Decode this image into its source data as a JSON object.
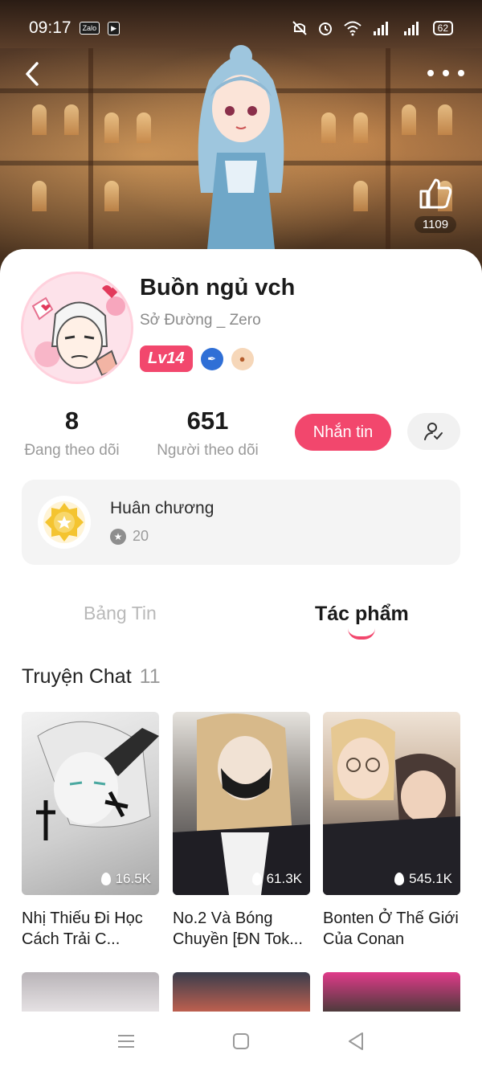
{
  "status_bar": {
    "time": "09:17",
    "app_icons": [
      "Zalo",
      "▶"
    ],
    "battery": "62"
  },
  "header": {
    "like_count": "1109"
  },
  "profile": {
    "name": "Buồn ngủ vch",
    "subtitle": "Sở Đường _ Zero",
    "level": "Lv14"
  },
  "stats": [
    {
      "value": "8",
      "label": "Đang theo dõi"
    },
    {
      "value": "651",
      "label": "Người theo dõi"
    }
  ],
  "actions": {
    "message_label": "Nhắn tin"
  },
  "medal": {
    "title": "Huân chương",
    "count": "20"
  },
  "tabs": [
    {
      "label": "Bảng Tin",
      "active": false
    },
    {
      "label": "Tác phẩm",
      "active": true
    }
  ],
  "section": {
    "title": "Truyện Chat",
    "count": "11"
  },
  "stories": [
    {
      "title": "Nhị Thiếu Đi Học Cách Trải C...",
      "views": "16.5K",
      "cover_color": "#d9d9d9"
    },
    {
      "title": "No.2 Và Bóng Chuyền [ĐN Tok...",
      "views": "61.3K",
      "cover_color": "#3c3a3f"
    },
    {
      "title": "Bonten Ở Thế Giới Của Conan",
      "views": "545.1K",
      "cover_color": "#6b5648"
    }
  ],
  "colors": {
    "accent": "#f2476d"
  }
}
